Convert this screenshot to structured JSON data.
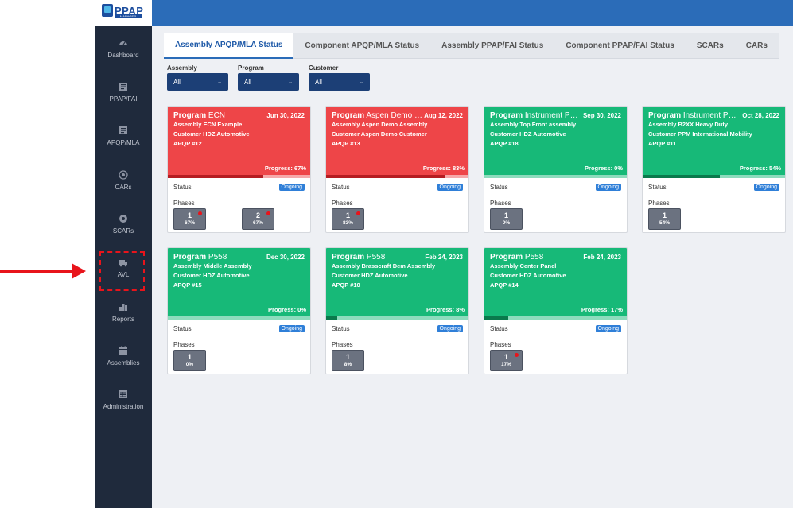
{
  "app": {
    "logo_text": "PPAP",
    "logo_sub": "MANAGER"
  },
  "sidebar": {
    "items": [
      {
        "label": "Dashboard",
        "icon": "gauge-icon"
      },
      {
        "label": "PPAP/FAI",
        "icon": "document-icon"
      },
      {
        "label": "APQP/MLA",
        "icon": "document-icon"
      },
      {
        "label": "CARs",
        "icon": "circle-icon"
      },
      {
        "label": "SCARs",
        "icon": "circle-icon"
      },
      {
        "label": "AVL",
        "icon": "truck-icon"
      },
      {
        "label": "Reports",
        "icon": "bar-chart-icon"
      },
      {
        "label": "Assemblies",
        "icon": "calendar-icon"
      },
      {
        "label": "Administration",
        "icon": "table-icon"
      }
    ]
  },
  "tabs": [
    {
      "label": "Assembly APQP/MLA Status",
      "active": true
    },
    {
      "label": "Component APQP/MLA Status",
      "active": false
    },
    {
      "label": "Assembly PPAP/FAI Status",
      "active": false
    },
    {
      "label": "Component PPAP/FAI Status",
      "active": false
    },
    {
      "label": "SCARs",
      "active": false
    },
    {
      "label": "CARs",
      "active": false
    }
  ],
  "filters": [
    {
      "label": "Assembly",
      "value": "All"
    },
    {
      "label": "Program",
      "value": "All"
    },
    {
      "label": "Customer",
      "value": "All"
    }
  ],
  "common": {
    "status_label": "Status",
    "phases_label": "Phases",
    "status_value": "Ongoing",
    "progress_prefix": "Progress: ",
    "program_prefix": "Program"
  },
  "cards": [
    {
      "color": "red",
      "program": "ECN",
      "date": "Jun 30, 2022",
      "assembly": "Assembly ECN Example",
      "customer": "Customer HDZ Automotive",
      "apqp": "APQP #12",
      "progress_text": "67%",
      "progress": 0.67,
      "phases": [
        {
          "num": "1",
          "pct": "67%",
          "dot": true
        },
        {
          "num": "2",
          "pct": "67%",
          "dot": true
        }
      ]
    },
    {
      "color": "red",
      "program": "Aspen Demo Pr...",
      "date": "Aug 12, 2022",
      "assembly": "Assembly Aspen Demo Assembly",
      "customer": "Customer Aspen Demo Customer",
      "apqp": "APQP #13",
      "progress_text": "83%",
      "progress": 0.83,
      "phases": [
        {
          "num": "1",
          "pct": "83%",
          "dot": true
        }
      ]
    },
    {
      "color": "green",
      "program": "Instrument Pan...",
      "date": "Sep 30, 2022",
      "assembly": "Assembly Top Front assembly",
      "customer": "Customer HDZ Automotive",
      "apqp": "APQP #18",
      "progress_text": "0%",
      "progress": 0,
      "phases": [
        {
          "num": "1",
          "pct": "0%",
          "dot": false
        }
      ]
    },
    {
      "color": "green",
      "program": "Instrument Pan...",
      "date": "Oct 28, 2022",
      "assembly": "Assembly B2XX Heavy Duty",
      "customer": "Customer PPM International Mobility",
      "apqp": "APQP #11",
      "progress_text": "54%",
      "progress": 0.54,
      "phases": [
        {
          "num": "1",
          "pct": "54%",
          "dot": false
        }
      ]
    },
    {
      "color": "green",
      "program": "P558",
      "date": "Dec 30, 2022",
      "assembly": "Assembly Middle Assembly",
      "customer": "Customer HDZ Automotive",
      "apqp": "APQP #15",
      "progress_text": "0%",
      "progress": 0,
      "phases": [
        {
          "num": "1",
          "pct": "0%",
          "dot": false
        }
      ]
    },
    {
      "color": "green",
      "program": "P558",
      "date": "Feb 24, 2023",
      "assembly": "Assembly Brasscraft Dem Assembly",
      "customer": "Customer HDZ Automotive",
      "apqp": "APQP #10",
      "progress_text": "8%",
      "progress": 0.08,
      "phases": [
        {
          "num": "1",
          "pct": "8%",
          "dot": false
        }
      ]
    },
    {
      "color": "green",
      "program": "P558",
      "date": "Feb 24, 2023",
      "assembly": "Assembly Center Panel",
      "customer": "Customer HDZ Automotive",
      "apqp": "APQP #14",
      "progress_text": "17%",
      "progress": 0.17,
      "phases": [
        {
          "num": "1",
          "pct": "17%",
          "dot": true
        }
      ]
    }
  ]
}
